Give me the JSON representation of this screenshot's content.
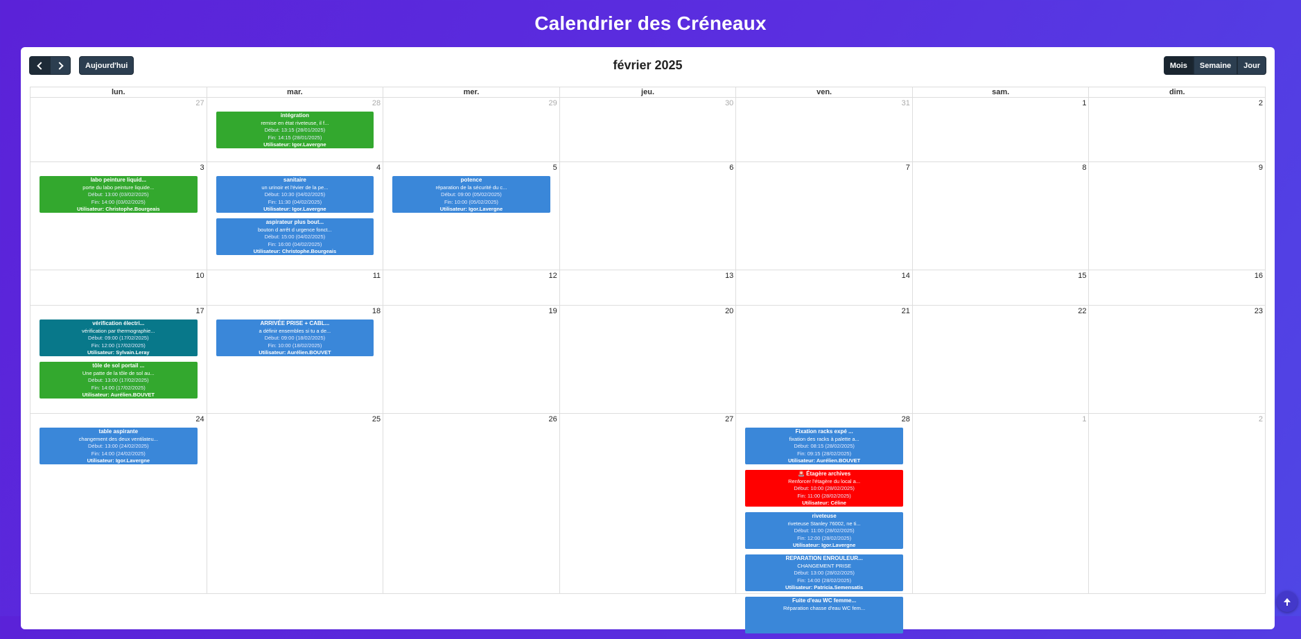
{
  "page_title": "Calendrier des Créneaux",
  "toolbar": {
    "today_label": "Aujourd'hui",
    "month_title": "février 2025",
    "views": [
      "Mois",
      "Semaine",
      "Jour"
    ],
    "active_view": "Mois",
    "prev_icon": "chevron-left-icon",
    "next_icon": "chevron-right-icon"
  },
  "weekdays": [
    "lun.",
    "mar.",
    "mer.",
    "jeu.",
    "ven.",
    "sam.",
    "dim."
  ],
  "colors": {
    "green": "#33a82e",
    "blue": "#3a87d9",
    "teal": "#08788a",
    "red": "#ff0000"
  },
  "weeks": [
    {
      "days": [
        {
          "num": "27",
          "other": true,
          "events": []
        },
        {
          "num": "28",
          "other": true,
          "events": [
            {
              "color": "green",
              "title": "intégration",
              "desc": "remise en état riveteuse, il f...",
              "start": "Début: 13:15 (28/01/2025)",
              "end": "Fin: 14:15 (28/01/2025)",
              "user": "Utilisateur: Igor.Lavergne"
            }
          ]
        },
        {
          "num": "29",
          "other": true,
          "events": []
        },
        {
          "num": "30",
          "other": true,
          "events": []
        },
        {
          "num": "31",
          "other": true,
          "events": []
        },
        {
          "num": "1",
          "other": false,
          "events": []
        },
        {
          "num": "2",
          "other": false,
          "events": []
        }
      ]
    },
    {
      "days": [
        {
          "num": "3",
          "other": false,
          "events": [
            {
              "color": "green",
              "title": "labo peinture liquid...",
              "desc": "porte du labo peinture liquide...",
              "start": "Début: 13:00 (03/02/2025)",
              "end": "Fin: 14:00 (03/02/2025)",
              "user": "Utilisateur: Christophe.Bourgeais"
            }
          ]
        },
        {
          "num": "4",
          "other": false,
          "events": [
            {
              "color": "blue",
              "title": "sanitaire",
              "desc": "un urinoir et l'évier de la pe...",
              "start": "Début: 10:30 (04/02/2025)",
              "end": "Fin: 11:30 (04/02/2025)",
              "user": "Utilisateur: Igor.Lavergne"
            },
            {
              "color": "blue",
              "title": "aspirateur plus bout...",
              "desc": "bouton d arrêt d urgence fonct...",
              "start": "Début: 15:00 (04/02/2025)",
              "end": "Fin: 16:00 (04/02/2025)",
              "user": "Utilisateur: Christophe.Bourgeais"
            }
          ]
        },
        {
          "num": "5",
          "other": false,
          "events": [
            {
              "color": "blue",
              "title": "potence",
              "desc": "réparation de la sécurité du c...",
              "start": "Début: 09:00 (05/02/2025)",
              "end": "Fin: 10:00 (05/02/2025)",
              "user": "Utilisateur: Igor.Lavergne"
            }
          ]
        },
        {
          "num": "6",
          "other": false,
          "events": []
        },
        {
          "num": "7",
          "other": false,
          "events": []
        },
        {
          "num": "8",
          "other": false,
          "events": []
        },
        {
          "num": "9",
          "other": false,
          "events": []
        }
      ]
    },
    {
      "days": [
        {
          "num": "10",
          "other": false,
          "events": []
        },
        {
          "num": "11",
          "other": false,
          "events": []
        },
        {
          "num": "12",
          "other": false,
          "events": []
        },
        {
          "num": "13",
          "other": false,
          "events": []
        },
        {
          "num": "14",
          "other": false,
          "events": []
        },
        {
          "num": "15",
          "other": false,
          "events": []
        },
        {
          "num": "16",
          "other": false,
          "events": []
        }
      ]
    },
    {
      "days": [
        {
          "num": "17",
          "other": false,
          "events": [
            {
              "color": "teal",
              "title": "vérification électri...",
              "desc": "vérification par thermographie...",
              "start": "Début: 09:00 (17/02/2025)",
              "end": "Fin: 12:00 (17/02/2025)",
              "user": "Utilisateur: Sylvain.Leray"
            },
            {
              "color": "green",
              "title": "tôle de sol portail ...",
              "desc": "Une patte de la tôle de sol au...",
              "start": "Début: 13:00 (17/02/2025)",
              "end": "Fin: 14:00 (17/02/2025)",
              "user": "Utilisateur: Aurélien.BOUVET"
            }
          ]
        },
        {
          "num": "18",
          "other": false,
          "events": [
            {
              "color": "blue",
              "title": "ARRIVÉE PRISE + CABL...",
              "desc": "a définir ensembles si tu a de...",
              "start": "Début: 09:00 (18/02/2025)",
              "end": "Fin: 10:00 (18/02/2025)",
              "user": "Utilisateur: Aurélien.BOUVET"
            }
          ]
        },
        {
          "num": "19",
          "other": false,
          "events": []
        },
        {
          "num": "20",
          "other": false,
          "events": []
        },
        {
          "num": "21",
          "other": false,
          "events": []
        },
        {
          "num": "22",
          "other": false,
          "events": []
        },
        {
          "num": "23",
          "other": false,
          "events": []
        }
      ]
    },
    {
      "days": [
        {
          "num": "24",
          "other": false,
          "events": [
            {
              "color": "blue",
              "title": "table aspirante",
              "desc": "changement des deux ventilateu...",
              "start": "Début: 13:00 (24/02/2025)",
              "end": "Fin: 14:00 (24/02/2025)",
              "user": "Utilisateur: Igor.Lavergne"
            }
          ]
        },
        {
          "num": "25",
          "other": false,
          "events": []
        },
        {
          "num": "26",
          "other": false,
          "events": []
        },
        {
          "num": "27",
          "other": false,
          "events": []
        },
        {
          "num": "28",
          "other": false,
          "events": [
            {
              "color": "blue",
              "title": "Fixation racks expé ...",
              "desc": "fixation des racks à palette a...",
              "start": "Début: 08:15 (28/02/2025)",
              "end": "Fin: 09:15 (28/02/2025)",
              "user": "Utilisateur: Aurélien.BOUVET"
            },
            {
              "color": "red",
              "title": "🚨 Étagère archives",
              "desc": "Renforcer l'étagère du local a...",
              "start": "Début: 10:00 (28/02/2025)",
              "end": "Fin: 11:00 (28/02/2025)",
              "user": "Utilisateur: Céline"
            },
            {
              "color": "blue",
              "title": "riveteuse",
              "desc": "riveteuse Stanley 76002, ne ti...",
              "start": "Début: 11:00 (28/02/2025)",
              "end": "Fin: 12:00 (28/02/2025)",
              "user": "Utilisateur: Igor.Lavergne"
            },
            {
              "color": "blue",
              "title": "REPARATION ENROULEUR...",
              "desc": "CHANGEMENT PRISE",
              "start": "Début: 13:00 (28/02/2025)",
              "end": "Fin: 14:00 (28/02/2025)",
              "user": "Utilisateur: Patricia.Semensatis"
            },
            {
              "color": "blue",
              "title": "Fuite d'eau WC femme...",
              "desc": "Réparation chasse d'eau WC fem...",
              "start": "",
              "end": "",
              "user": ""
            }
          ]
        },
        {
          "num": "1",
          "other": true,
          "events": []
        },
        {
          "num": "2",
          "other": true,
          "events": []
        }
      ]
    }
  ]
}
